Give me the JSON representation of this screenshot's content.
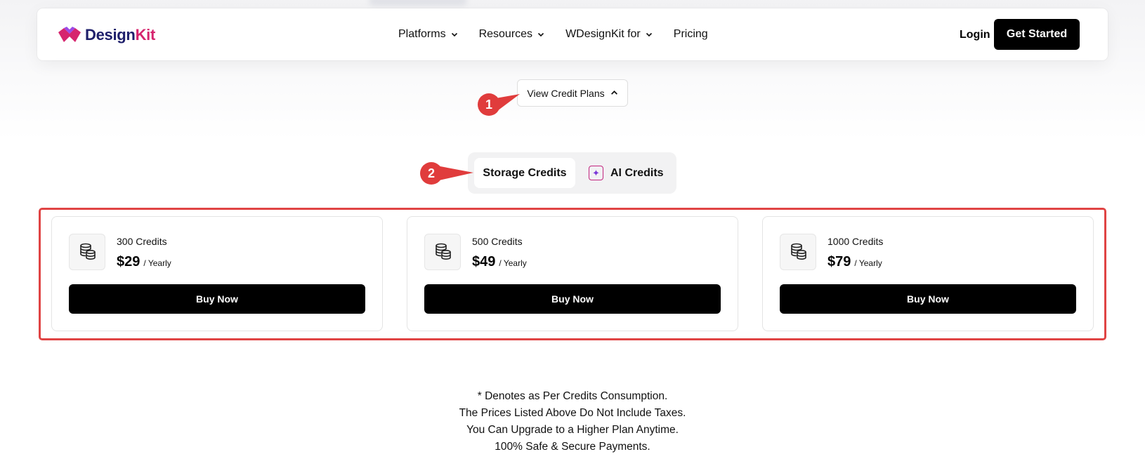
{
  "brand": {
    "name_part1": "Design",
    "name_part2": "Kit",
    "colors": {
      "navy": "#1e1f6b",
      "pink": "#d6246e",
      "callout_red": "#e03c3c",
      "outline_red": "#e04444"
    }
  },
  "nav": {
    "items": [
      {
        "label": "Platforms",
        "has_dropdown": true
      },
      {
        "label": "Resources",
        "has_dropdown": true
      },
      {
        "label": "WDesignKit for",
        "has_dropdown": true
      },
      {
        "label": "Pricing",
        "has_dropdown": false
      }
    ],
    "login_label": "Login",
    "get_started_label": "Get Started"
  },
  "view_plans": {
    "label": "View Credit Plans",
    "icon": "chevron-up-icon"
  },
  "callouts": {
    "one": "1",
    "two": "2"
  },
  "tabs": {
    "storage_label": "Storage Credits",
    "ai_label": "AI Credits",
    "active": "storage"
  },
  "plans": [
    {
      "credits": "300 Credits",
      "price": "$29",
      "period": "/ Yearly",
      "button": "Buy Now",
      "icon": "database-coins-icon"
    },
    {
      "credits": "500 Credits",
      "price": "$49",
      "period": "/ Yearly",
      "button": "Buy Now",
      "icon": "database-coins-icon"
    },
    {
      "credits": "1000 Credits",
      "price": "$79",
      "period": "/ Yearly",
      "button": "Buy Now",
      "icon": "database-coins-icon"
    }
  ],
  "notes": [
    "* Denotes as Per Credits Consumption.",
    "The Prices Listed Above Do Not Include Taxes.",
    "You Can Upgrade to a Higher Plan Anytime.",
    "100% Safe & Secure Payments."
  ]
}
